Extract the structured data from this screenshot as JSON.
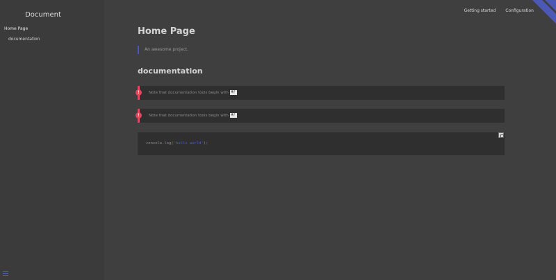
{
  "app": {
    "title": "Document"
  },
  "sidebar": {
    "items": [
      {
        "label": "Home Page"
      },
      {
        "label": "documentation"
      }
    ]
  },
  "topnav": {
    "links": [
      {
        "label": "Getting started"
      },
      {
        "label": "Configuration"
      }
    ]
  },
  "main": {
    "title": "Home Page",
    "quote": "An awesome project.",
    "section_title": "documentation",
    "tips": [
      {
        "icon": "!",
        "text": "Note that documentation tools begin with ",
        "code": "#/"
      },
      {
        "icon": "!",
        "text": "Note that documentation tools begin with ",
        "code": "#/"
      }
    ],
    "code": {
      "prefix": "console.log(",
      "string": "'hello world'",
      "suffix": ");"
    }
  },
  "colors": {
    "accent": "#4b58b5",
    "tip": "#e0485c",
    "background": "#3f3f3f",
    "panel": "#2f2f2f"
  }
}
